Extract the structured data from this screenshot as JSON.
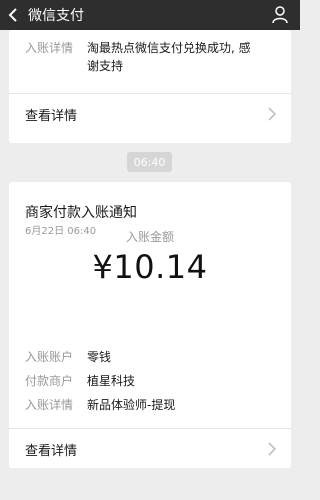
{
  "header": {
    "title": "微信支付",
    "back_icon": "back-chevron-icon",
    "user_icon": "user-icon"
  },
  "top_card": {
    "row": {
      "label": "入账详情",
      "value_line1": "淘最热点微信支付兑换成功, 感",
      "value_line2": "谢支持"
    },
    "details_label": "查看详情"
  },
  "time_divider": "06:40",
  "notice_card": {
    "title": "商家付款入账通知",
    "date": "6月22日  06:40",
    "amount_label": "入账金额",
    "amount": "¥10.14",
    "rows": [
      {
        "label": "入账账户",
        "value": "零钱"
      },
      {
        "label": "付款商户",
        "value": "植星科技"
      },
      {
        "label": "入账详情",
        "value": "新品体验师-提现"
      }
    ],
    "details_label": "查看详情"
  },
  "colors": {
    "navbar": "#2e2e2e",
    "background": "#ededed",
    "card": "#ffffff",
    "muted_text": "#9a9a9a"
  }
}
